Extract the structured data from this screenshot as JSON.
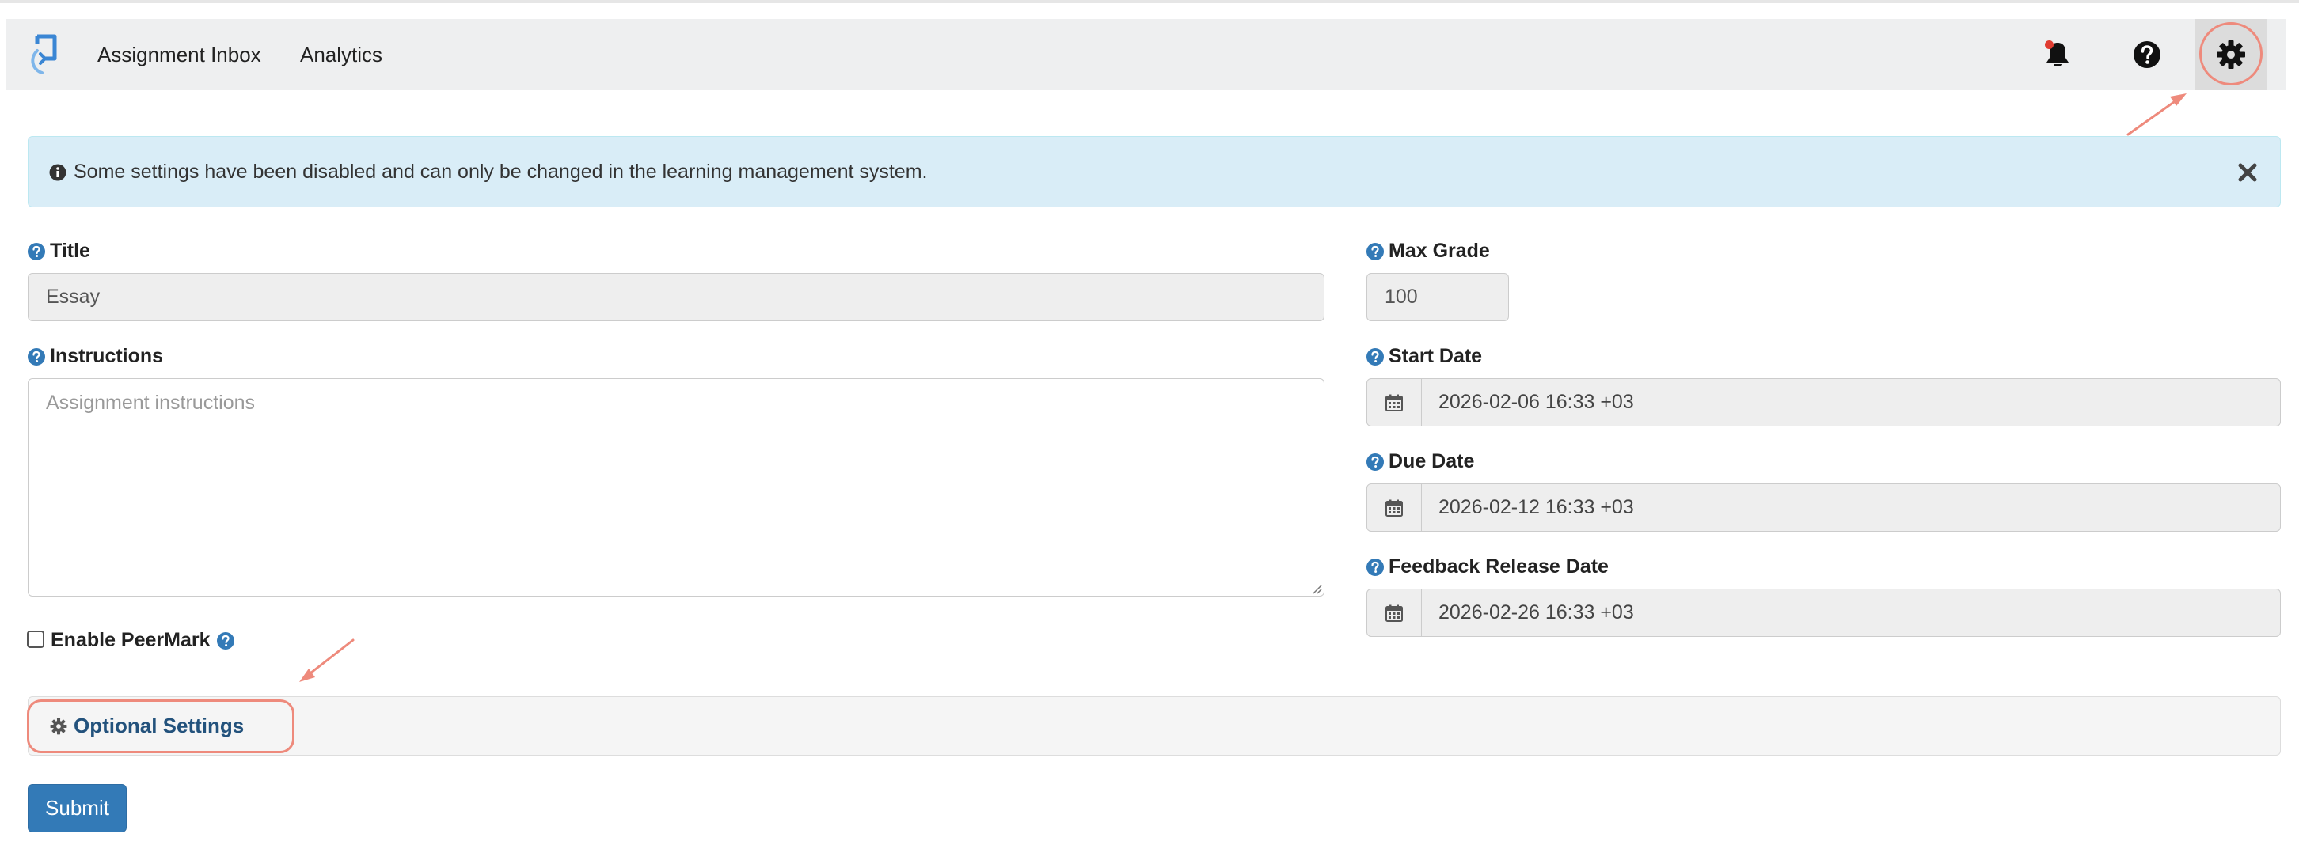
{
  "nav": {
    "links": [
      "Assignment Inbox",
      "Analytics"
    ],
    "icons": [
      "notifications-bell-icon",
      "help-icon",
      "settings-gear-icon"
    ],
    "has_notification": true
  },
  "alert": {
    "text": "Some settings have been disabled and can only be changed in the learning management system.",
    "color": "#d9edf7"
  },
  "form": {
    "title": {
      "label": "Title",
      "value": "Essay"
    },
    "instructions": {
      "label": "Instructions",
      "placeholder": "Assignment instructions"
    },
    "peermark": {
      "label": "Enable PeerMark",
      "checked": false
    },
    "max_grade": {
      "label": "Max Grade",
      "value": "100"
    },
    "start_date": {
      "label": "Start Date",
      "value": "2026-02-06 16:33 +03"
    },
    "due_date": {
      "label": "Due Date",
      "value": "2026-02-12 16:33 +03"
    },
    "feedback_date": {
      "label": "Feedback Release Date",
      "value": "2026-02-26 16:33 +03"
    },
    "optional_settings": "Optional Settings",
    "submit": "Submit"
  },
  "colors": {
    "accent": "#337ab7",
    "link": "#23527c",
    "annotation": "#ee8a7c"
  }
}
